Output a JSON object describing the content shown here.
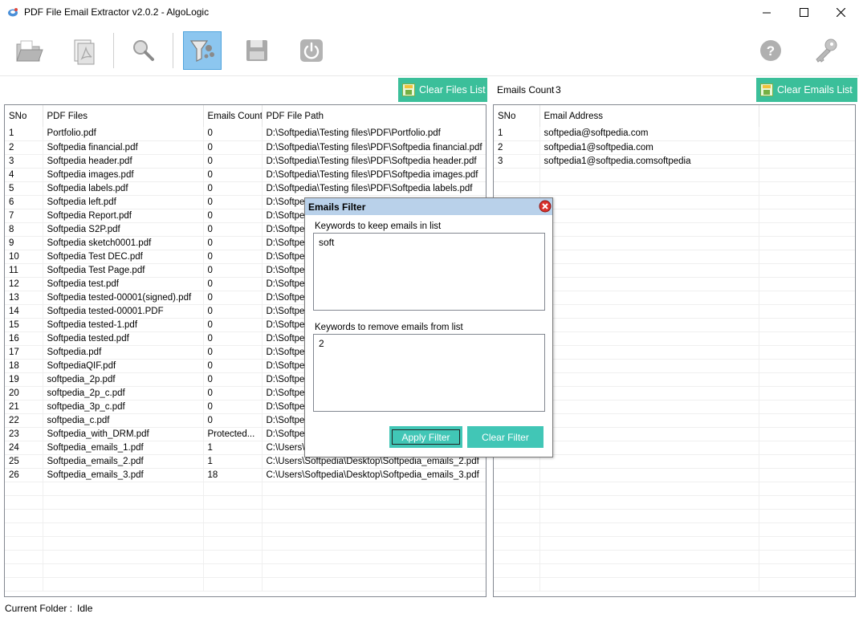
{
  "window": {
    "title": "PDF File Email Extractor v2.0.2 - AlgoLogic"
  },
  "toolbar": {
    "buttons": [
      "open-folder",
      "open-file",
      "search",
      "filter",
      "save",
      "power",
      "help",
      "key"
    ],
    "active": "filter"
  },
  "left_panel": {
    "clear_label": "Clear Files List",
    "columns": [
      "SNo",
      "PDF Files",
      "Emails Count",
      "PDF File Path"
    ],
    "rows": [
      [
        "1",
        "Portfolio.pdf",
        "0",
        "D:\\Softpedia\\Testing files\\PDF\\Portfolio.pdf"
      ],
      [
        "2",
        "Softpedia financial.pdf",
        "0",
        "D:\\Softpedia\\Testing files\\PDF\\Softpedia financial.pdf"
      ],
      [
        "3",
        "Softpedia header.pdf",
        "0",
        "D:\\Softpedia\\Testing files\\PDF\\Softpedia header.pdf"
      ],
      [
        "4",
        "Softpedia images.pdf",
        "0",
        "D:\\Softpedia\\Testing files\\PDF\\Softpedia images.pdf"
      ],
      [
        "5",
        "Softpedia labels.pdf",
        "0",
        "D:\\Softpedia\\Testing files\\PDF\\Softpedia labels.pdf"
      ],
      [
        "6",
        "Softpedia left.pdf",
        "0",
        "D:\\Softpe"
      ],
      [
        "7",
        "Softpedia Report.pdf",
        "0",
        "D:\\Softpe"
      ],
      [
        "8",
        "Softpedia S2P.pdf",
        "0",
        "D:\\Softpe"
      ],
      [
        "9",
        "Softpedia sketch0001.pdf",
        "0",
        "D:\\Softpe"
      ],
      [
        "10",
        "Softpedia Test DEC.pdf",
        "0",
        "D:\\Softpe"
      ],
      [
        "11",
        "Softpedia Test Page.pdf",
        "0",
        "D:\\Softpe"
      ],
      [
        "12",
        "Softpedia test.pdf",
        "0",
        "D:\\Softpe"
      ],
      [
        "13",
        "Softpedia tested-00001(signed).pdf",
        "0",
        "D:\\Softpe"
      ],
      [
        "14",
        "Softpedia tested-00001.PDF",
        "0",
        "D:\\Softpe"
      ],
      [
        "15",
        "Softpedia tested-1.pdf",
        "0",
        "D:\\Softpe"
      ],
      [
        "16",
        "Softpedia tested.pdf",
        "0",
        "D:\\Softpe"
      ],
      [
        "17",
        "Softpedia.pdf",
        "0",
        "D:\\Softpe"
      ],
      [
        "18",
        "SoftpediaQIF.pdf",
        "0",
        "D:\\Softpe"
      ],
      [
        "19",
        "softpedia_2p.pdf",
        "0",
        "D:\\Softpe"
      ],
      [
        "20",
        "softpedia_2p_c.pdf",
        "0",
        "D:\\Softpe"
      ],
      [
        "21",
        "softpedia_3p_c.pdf",
        "0",
        "D:\\Softpe"
      ],
      [
        "22",
        "softpedia_c.pdf",
        "0",
        "D:\\Softpe"
      ],
      [
        "23",
        "Softpedia_with_DRM.pdf",
        "Protected...",
        "D:\\Softpe"
      ],
      [
        "24",
        "Softpedia_emails_1.pdf",
        "1",
        "C:\\Users\\"
      ],
      [
        "25",
        "Softpedia_emails_2.pdf",
        "1",
        "C:\\Users\\Softpedia\\Desktop\\Softpedia_emails_2.pdf"
      ],
      [
        "26",
        "Softpedia_emails_3.pdf",
        "18",
        "C:\\Users\\Softpedia\\Desktop\\Softpedia_emails_3.pdf"
      ]
    ]
  },
  "right_panel": {
    "count_label": "Emails Count",
    "count_value": "3",
    "clear_label": "Clear Emails List",
    "columns": [
      "SNo",
      "Email Address"
    ],
    "rows": [
      [
        "1",
        "softpedia@softpedia.com"
      ],
      [
        "2",
        "softpedia1@softpedia.com"
      ],
      [
        "3",
        "softpedia1@softpedia.comsoftpedia"
      ]
    ]
  },
  "status": {
    "label": "Current Folder :",
    "value": "Idle"
  },
  "dialog": {
    "title": "Emails Filter",
    "keep_label": "Keywords to keep emails in list",
    "keep_value": "soft",
    "remove_label": "Keywords to remove emails from list",
    "remove_value": "2",
    "apply_label": "Apply Filter",
    "clear_label": "Clear Filter"
  }
}
